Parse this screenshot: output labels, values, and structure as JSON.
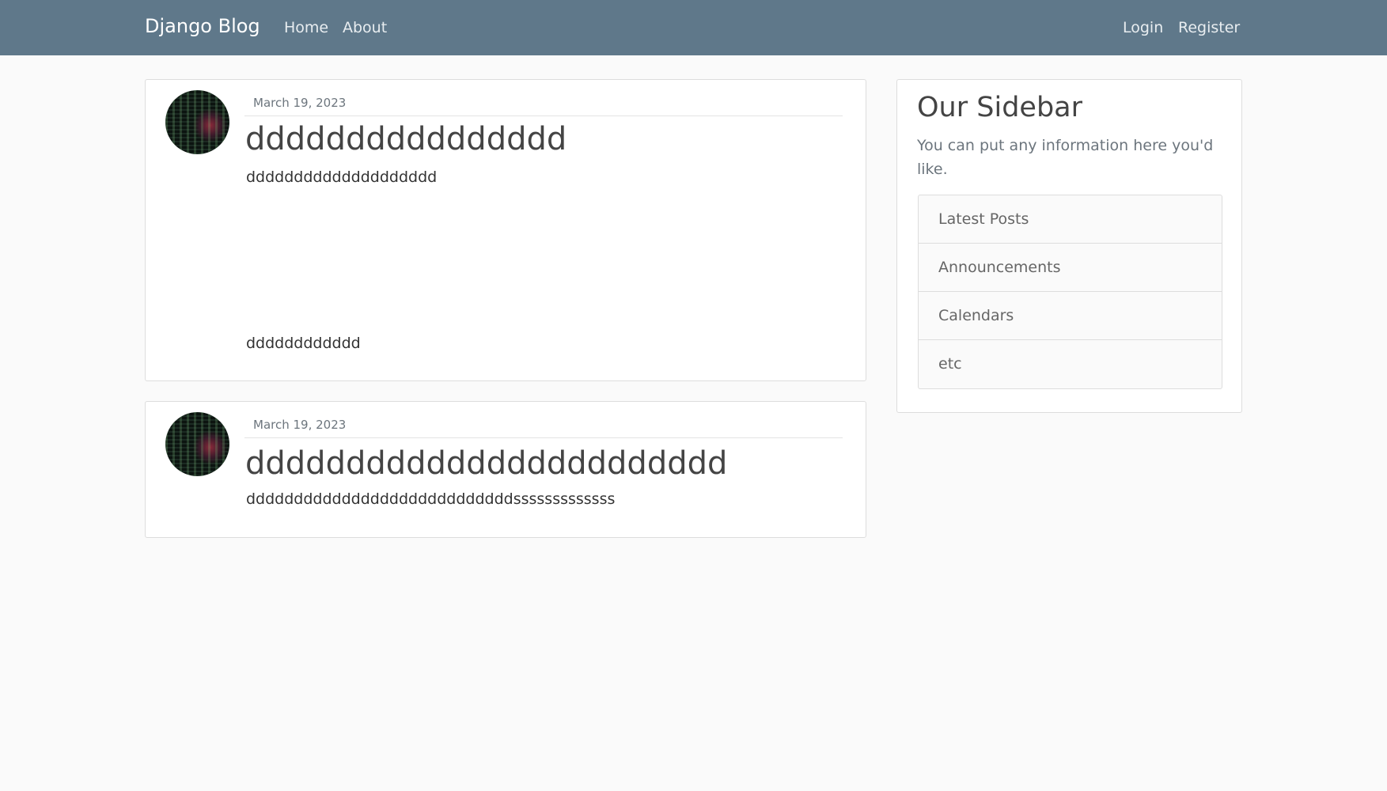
{
  "navbar": {
    "brand": "Django Blog",
    "links_left": [
      "Home",
      "About"
    ],
    "links_right": [
      "Login",
      "Register"
    ],
    "background": "#5f788a"
  },
  "posts": [
    {
      "avatar": "user-avatar",
      "date": "March 19, 2023",
      "title": "dddddddddddddddd",
      "body_lines": [
        "dddddddddddddddddddd",
        "dddddddddddd"
      ]
    },
    {
      "avatar": "user-avatar",
      "date": "March 19, 2023",
      "title": "dddddddddddddddddddddddd",
      "body_lines": [
        "ddddddddddddddddddddddddddddsssssssssssss"
      ]
    }
  ],
  "sidebar": {
    "title": "Our Sidebar",
    "text": "You can put any information here you'd like.",
    "items": [
      "Latest Posts",
      "Announcements",
      "Calendars",
      "etc"
    ]
  }
}
